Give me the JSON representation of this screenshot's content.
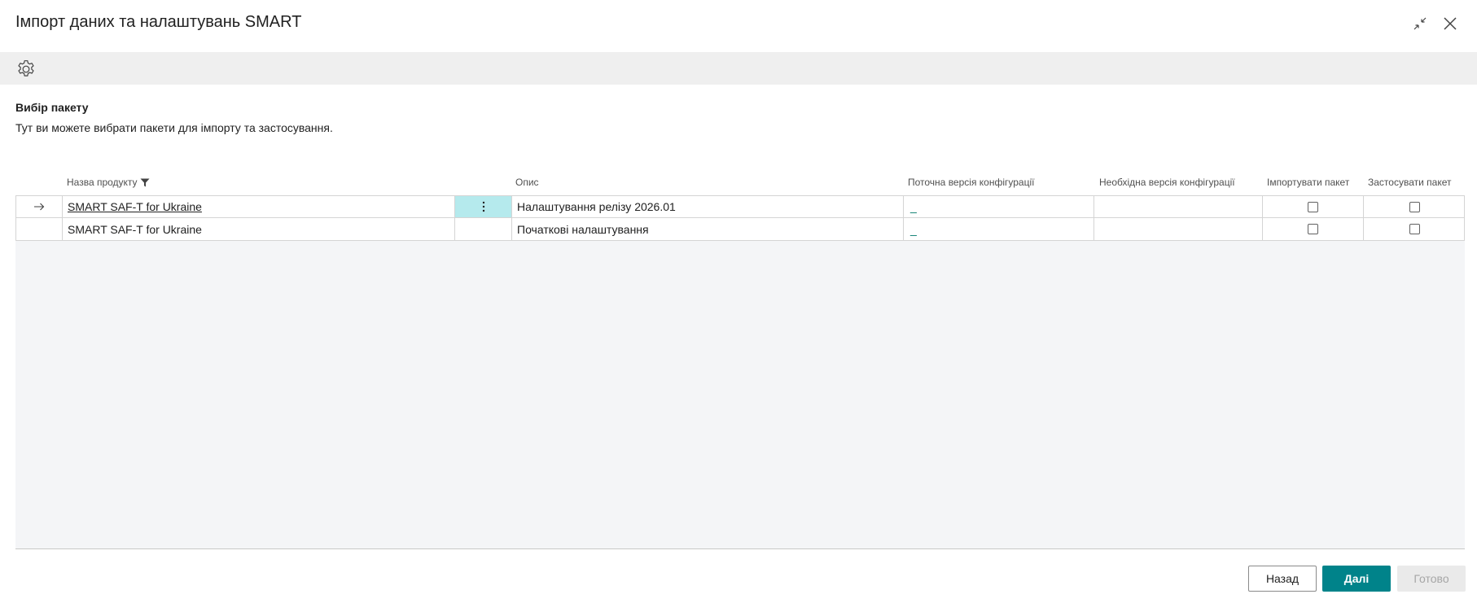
{
  "window": {
    "title": "Імпорт даних та налаштувань SMART"
  },
  "icons": {
    "collapse": "collapse-icon",
    "close": "close-icon",
    "settings": "gear-icon",
    "filter": "filter-icon",
    "row_arrow": "arrow-right-icon",
    "row_menu": "more-vertical-icon"
  },
  "section": {
    "title": "Вибір пакету",
    "description": "Тут ви можете вибрати пакети для імпорту та застосування."
  },
  "table": {
    "headers": {
      "product_name": "Назва продукту",
      "description": "Опис",
      "current_version": "Поточна версія конфігурації",
      "required_version": "Необхідна версія конфігурації",
      "import_package": "Імпортувати пакет",
      "apply_package": "Застосувати пакет"
    },
    "rows": [
      {
        "product_name": "SMART SAF-T for Ukraine",
        "description": "Налаштування релізу 2026.01",
        "current_version": "_",
        "required_version": "",
        "import_package": false,
        "apply_package": false,
        "selected": true
      },
      {
        "product_name": "SMART SAF-T for Ukraine",
        "description": "Початкові налаштування",
        "current_version": "_",
        "required_version": "",
        "import_package": false,
        "apply_package": false,
        "selected": false
      }
    ]
  },
  "footer": {
    "back_label": "Назад",
    "next_label": "Далі",
    "done_label": "Готово"
  },
  "colors": {
    "primary": "#00838a",
    "active_cell": "#b5eaed",
    "action_bar": "#efefef",
    "grid_background": "#f4f5f7"
  }
}
